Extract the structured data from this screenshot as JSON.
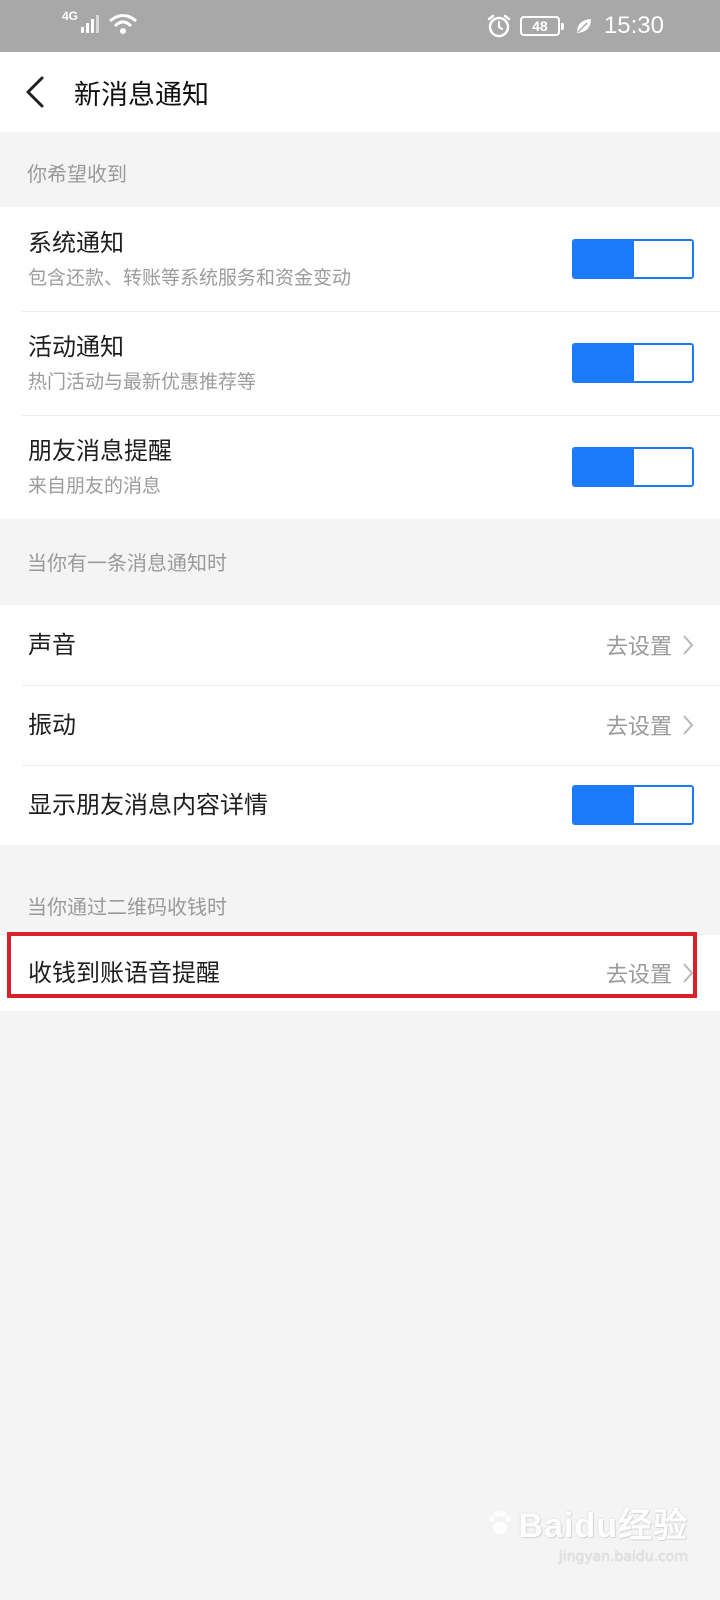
{
  "status_bar": {
    "network": "4G",
    "battery": "48",
    "time": "15:30"
  },
  "nav": {
    "title": "新消息通知"
  },
  "sections": [
    {
      "header": "你希望收到",
      "rows": [
        {
          "title": "系统通知",
          "subtitle": "包含还款、转账等系统服务和资金变动",
          "toggle_on": true
        },
        {
          "title": "活动通知",
          "subtitle": "热门活动与最新优惠推荐等",
          "toggle_on": true
        },
        {
          "title": "朋友消息提醒",
          "subtitle": "来自朋友的消息",
          "toggle_on": true
        }
      ]
    },
    {
      "header": "当你有一条消息通知时",
      "rows": [
        {
          "title": "声音",
          "action": "去设置"
        },
        {
          "title": "振动",
          "action": "去设置"
        },
        {
          "title": "显示朋友消息内容详情",
          "toggle_on": true
        }
      ]
    },
    {
      "header": "当你通过二维码收钱时",
      "rows": [
        {
          "title": "收钱到账语音提醒",
          "action": "去设置"
        }
      ]
    }
  ],
  "watermark": {
    "brand": "Baidu经验",
    "url": "jingyan.baidu.com"
  },
  "colors": {
    "accent": "#1a7af8",
    "highlight": "#d9202b",
    "status_bar": "#a8a8a8",
    "background": "#f4f4f4"
  }
}
